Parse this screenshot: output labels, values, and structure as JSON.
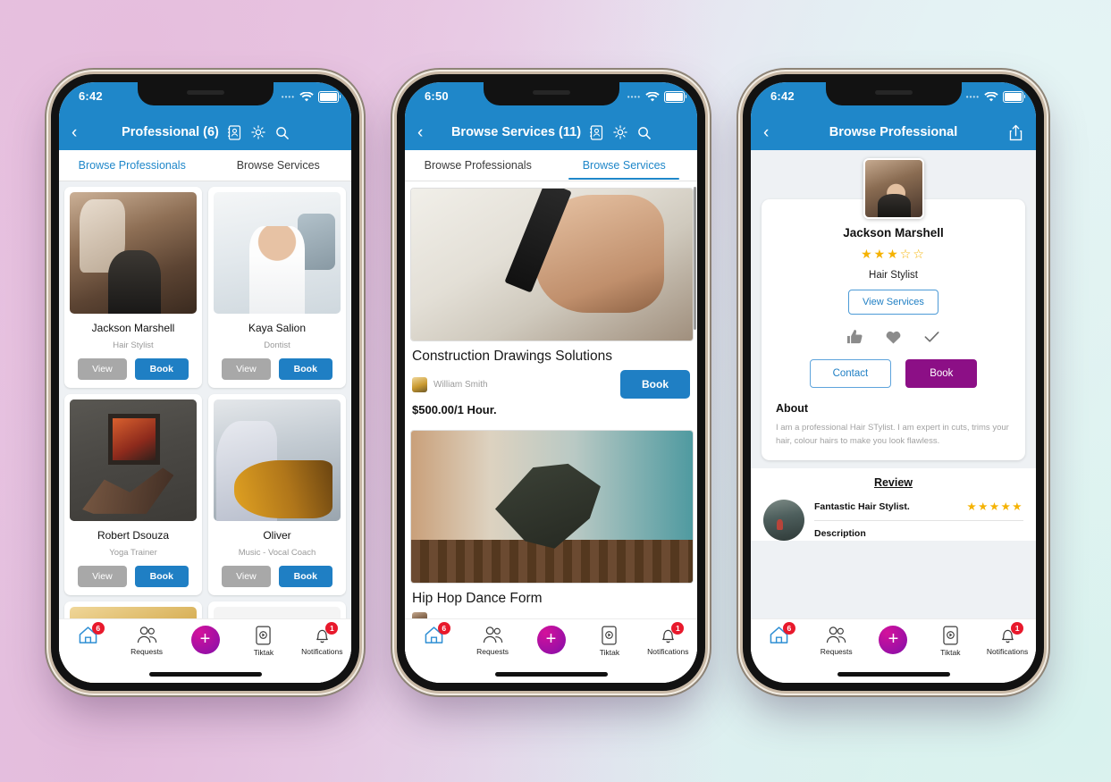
{
  "background": {
    "left_color": "#e8c3e2",
    "right_color": "#e4f4f4"
  },
  "theme": {
    "appbar_blue": "#1f87c9",
    "button_blue": "#1f7fc4",
    "magenta": "#8c0f86",
    "star_gold": "#f5b200",
    "badge_red": "#e8192c"
  },
  "bottom_nav": {
    "items": [
      {
        "name": "home",
        "label": "",
        "icon": "home-icon",
        "badge": "6"
      },
      {
        "name": "requests",
        "label": "Requests",
        "icon": "people-icon",
        "badge": ""
      },
      {
        "name": "add",
        "label": "",
        "icon": "plus-icon",
        "badge": ""
      },
      {
        "name": "tiktak",
        "label": "Tiktak",
        "icon": "video-phone-icon",
        "badge": ""
      },
      {
        "name": "notifications",
        "label": "Notifications",
        "icon": "bell-icon",
        "badge": "1"
      }
    ]
  },
  "phone1": {
    "status": {
      "time": "6:42",
      "wifi": "wifi-icon",
      "battery": "battery-full-icon"
    },
    "appbar": {
      "back": "‹",
      "title": "Professional (6)",
      "icons": [
        "contacts-book-icon",
        "gear-icon",
        "search-icon"
      ]
    },
    "tabs": [
      {
        "label": "Browse Professionals",
        "active": true
      },
      {
        "label": "Browse Services",
        "active": false
      }
    ],
    "cards": [
      {
        "name": "Jackson Marshell",
        "role": "Hair Stylist",
        "view": "View",
        "book": "Book",
        "photo": "ph-barber"
      },
      {
        "name": "Kaya Salion",
        "role": "Dontist",
        "view": "View",
        "book": "Book",
        "photo": "ph-dentist"
      },
      {
        "name": "Robert Dsouza",
        "role": "Yoga Trainer",
        "view": "View",
        "book": "Book",
        "photo": "ph-yoga"
      },
      {
        "name": "Oliver",
        "role": "Music - Vocal Coach",
        "view": "View",
        "book": "Book",
        "photo": "ph-guitar"
      }
    ]
  },
  "phone2": {
    "status": {
      "time": "6:50"
    },
    "appbar": {
      "back": "‹",
      "title": "Browse Services (11)"
    },
    "tabs": [
      {
        "label": "Browse Professionals",
        "active": false
      },
      {
        "label": "Browse Services",
        "active": true
      }
    ],
    "services": [
      {
        "title": "Construction Drawings Solutions",
        "author": "William Smith",
        "price": "$500.00/1 Hour.",
        "book": "Book",
        "photo": "ph-draw"
      },
      {
        "title": "Hip Hop Dance Form",
        "author": "",
        "price": "",
        "book": "",
        "photo": "ph-dance"
      }
    ]
  },
  "phone3": {
    "status": {
      "time": "6:42"
    },
    "appbar": {
      "back": "‹",
      "title": "Browse Professional",
      "right_icon": "share-icon"
    },
    "profile": {
      "name": "Jackson Marshell",
      "stars_filled": 3,
      "stars_total": 5,
      "role": "Hair Stylist",
      "view_services": "View Services",
      "reactions": [
        "thumbs-up-icon",
        "heart-icon",
        "check-icon"
      ],
      "contact": "Contact",
      "book": "Book",
      "about_heading": "About",
      "about_text": "I am a professional Hair STylist. I am expert in cuts, trims your hair, colour hairs to make you look flawless."
    },
    "review": {
      "heading": "Review",
      "title": "Fantastic Hair Stylist.",
      "stars": 5,
      "description_label": "Description"
    }
  }
}
